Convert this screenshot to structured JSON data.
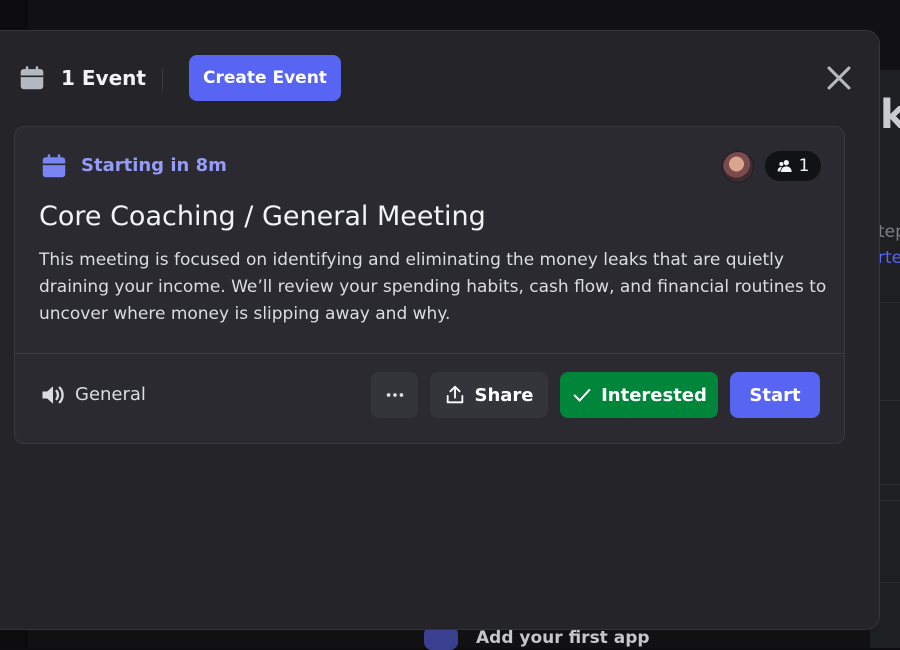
{
  "background": {
    "heading_fragment": "k",
    "text_fragment_a": "tep",
    "text_fragment_b": "rte",
    "app_hint": "Add your first app"
  },
  "header": {
    "title": "1 Event",
    "create_button": "Create Event",
    "icons": {
      "calendar": "calendar-icon",
      "close": "close-icon"
    }
  },
  "event": {
    "status": "Starting in 8m",
    "interested_count": "1",
    "title": "Core Coaching / General Meeting",
    "description": "This meeting is focused on identifying and eliminating the money leaks that are quietly draining your income. We’ll review your spending habits, cash flow, and financial routines to uncover where money is slipping away and why.",
    "channel": "General",
    "actions": {
      "share": "Share",
      "interested": "Interested",
      "start": "Start"
    }
  },
  "colors": {
    "accent": "#5865f2",
    "status_text": "#949cf7",
    "interested_green": "#00863a",
    "modal_bg": "#242429",
    "card_bg": "#2a2a30"
  }
}
